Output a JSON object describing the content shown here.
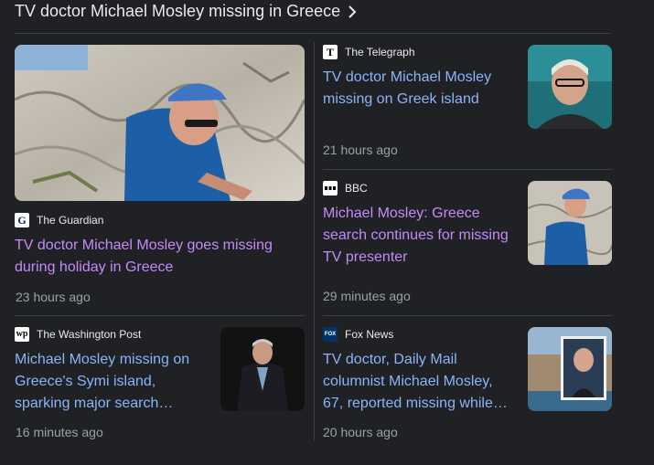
{
  "section": {
    "title": "TV doctor Michael Mosley missing in Greece"
  },
  "articles": [
    {
      "source": "The Guardian",
      "headline": "TV doctor Michael Mosley goes missing during holiday in Greece",
      "time": "23 hours ago",
      "visited": true
    },
    {
      "source": "The Telegraph",
      "headline": "TV doctor Michael Mosley missing on Greek island",
      "time": "21 hours ago",
      "visited": false
    },
    {
      "source": "BBC",
      "headline": "Michael Mosley: Greece search continues for missing TV presenter",
      "time": "29 minutes ago",
      "visited": true
    },
    {
      "source": "The Washington Post",
      "headline": "Michael Mosley missing on Greece's Symi island, sparking major search…",
      "time": "16 minutes ago",
      "visited": false
    },
    {
      "source": "Fox News",
      "headline": "TV doctor, Daily Mail columnist Michael Mosley, 67, reported missing while…",
      "time": "20 hours ago",
      "visited": false
    }
  ],
  "colors": {
    "background": "#202124",
    "link": "#8ab4f8",
    "visited_link": "#c58af9",
    "meta": "#9aa0a6"
  }
}
